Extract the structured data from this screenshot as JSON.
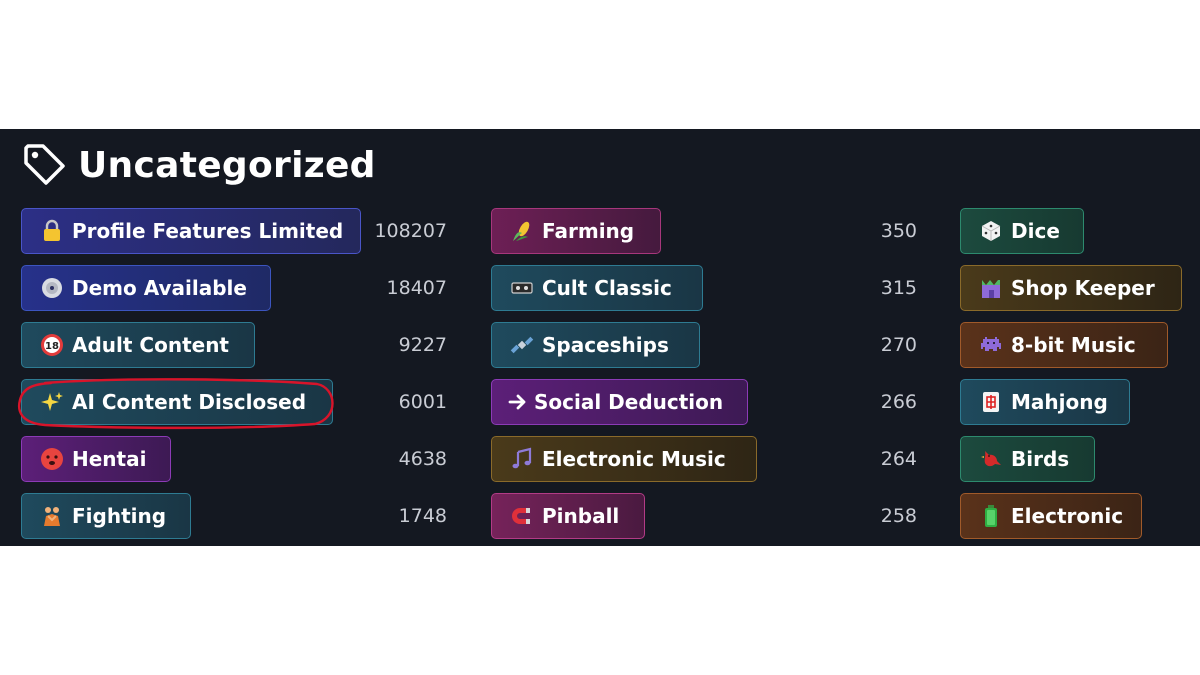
{
  "section": {
    "title": "Uncategorized",
    "icon": "tag-icon"
  },
  "columns": [
    {
      "items": [
        {
          "label": "Profile Features Limited",
          "count": "108207",
          "icon": "lock-icon",
          "theme": "c-blue"
        },
        {
          "label": "Demo Available",
          "count": "18407",
          "icon": "disc-icon",
          "theme": "c-blue2"
        },
        {
          "label": "Adult Content",
          "count": "9227",
          "icon": "eighteen-icon",
          "theme": "c-teal"
        },
        {
          "label": "AI Content Disclosed",
          "count": "6001",
          "icon": "sparkles-icon",
          "theme": "c-teal"
        },
        {
          "label": "Hentai",
          "count": "4638",
          "icon": "flushed-face-icon",
          "theme": "c-purple"
        },
        {
          "label": "Fighting",
          "count": "1748",
          "icon": "wrestlers-icon",
          "theme": "c-teal"
        }
      ]
    },
    {
      "items": [
        {
          "label": "Farming",
          "count": "350",
          "icon": "corn-icon",
          "theme": "c-magenta"
        },
        {
          "label": "Cult Classic",
          "count": "315",
          "icon": "videotape-icon",
          "theme": "c-teal"
        },
        {
          "label": "Spaceships",
          "count": "270",
          "icon": "satellite-icon",
          "theme": "c-teal"
        },
        {
          "label": "Social Deduction",
          "count": "266",
          "icon": "arrow-right-icon",
          "theme": "c-purple"
        },
        {
          "label": "Electronic Music",
          "count": "264",
          "icon": "music-notes-icon",
          "theme": "c-brown"
        },
        {
          "label": "Pinball",
          "count": "258",
          "icon": "magnet-icon",
          "theme": "c-pink"
        }
      ]
    },
    {
      "items": [
        {
          "label": "Dice",
          "icon": "die-icon",
          "theme": "c-green"
        },
        {
          "label": "Shop Keeper",
          "icon": "store-icon",
          "theme": "c-brown"
        },
        {
          "label": "8-bit Music",
          "icon": "space-invader-icon",
          "theme": "c-orange"
        },
        {
          "label": "Mahjong",
          "icon": "mahjong-tile-icon",
          "theme": "c-teal"
        },
        {
          "label": "Birds",
          "icon": "bird-icon",
          "theme": "c-green"
        },
        {
          "label": "Electronic",
          "icon": "battery-icon",
          "theme": "c-orange"
        }
      ]
    }
  ],
  "annotation": {
    "type": "red-ellipse",
    "color": "#d8142a",
    "target": "AI Content Disclosed"
  }
}
